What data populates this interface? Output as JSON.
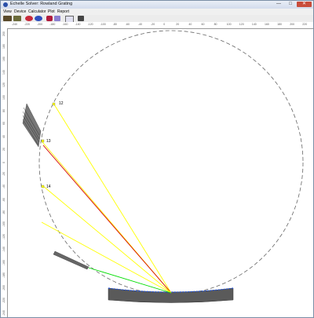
{
  "window": {
    "title": "Echelle Solver: Rowland Grating"
  },
  "title_buttons": {
    "minimize": "—",
    "maximize": "□",
    "close": "✕"
  },
  "menu": [
    "View",
    "Device",
    "Calculator",
    "Plot",
    "Report"
  ],
  "toolbar": {
    "buttons": [
      "open-icon",
      "cart-icon",
      "grating-red-icon",
      "grating-blue-icon",
      "ray-icon",
      "calendar-icon",
      "chart-icon",
      "print-icon"
    ]
  },
  "rulers": {
    "top": [
      "-240",
      "-220",
      "-200",
      "-180",
      "-160",
      "-140",
      "-120",
      "-100",
      "-80",
      "-60",
      "-40",
      "-20",
      "0",
      "20",
      "40",
      "60",
      "80",
      "100",
      "120",
      "140",
      "160",
      "180",
      "200",
      "220",
      "240"
    ],
    "left": [
      "200",
      "180",
      "160",
      "140",
      "120",
      "100",
      "80",
      "60",
      "40",
      "20",
      "0",
      "-20",
      "-40",
      "-60",
      "-80",
      "-100",
      "-120",
      "-140",
      "-160",
      "-180",
      "-200",
      "-220",
      "-240"
    ]
  },
  "orders": [
    {
      "label": "12"
    },
    {
      "label": "13"
    },
    {
      "label": "14"
    }
  ],
  "colors": {
    "ray_yellow": "#ffff00",
    "ray_red": "#d40000",
    "ray_green": "#00dd00",
    "circle": "#666666",
    "grating": "#555555",
    "grating_edge": "#1e4fd8"
  }
}
